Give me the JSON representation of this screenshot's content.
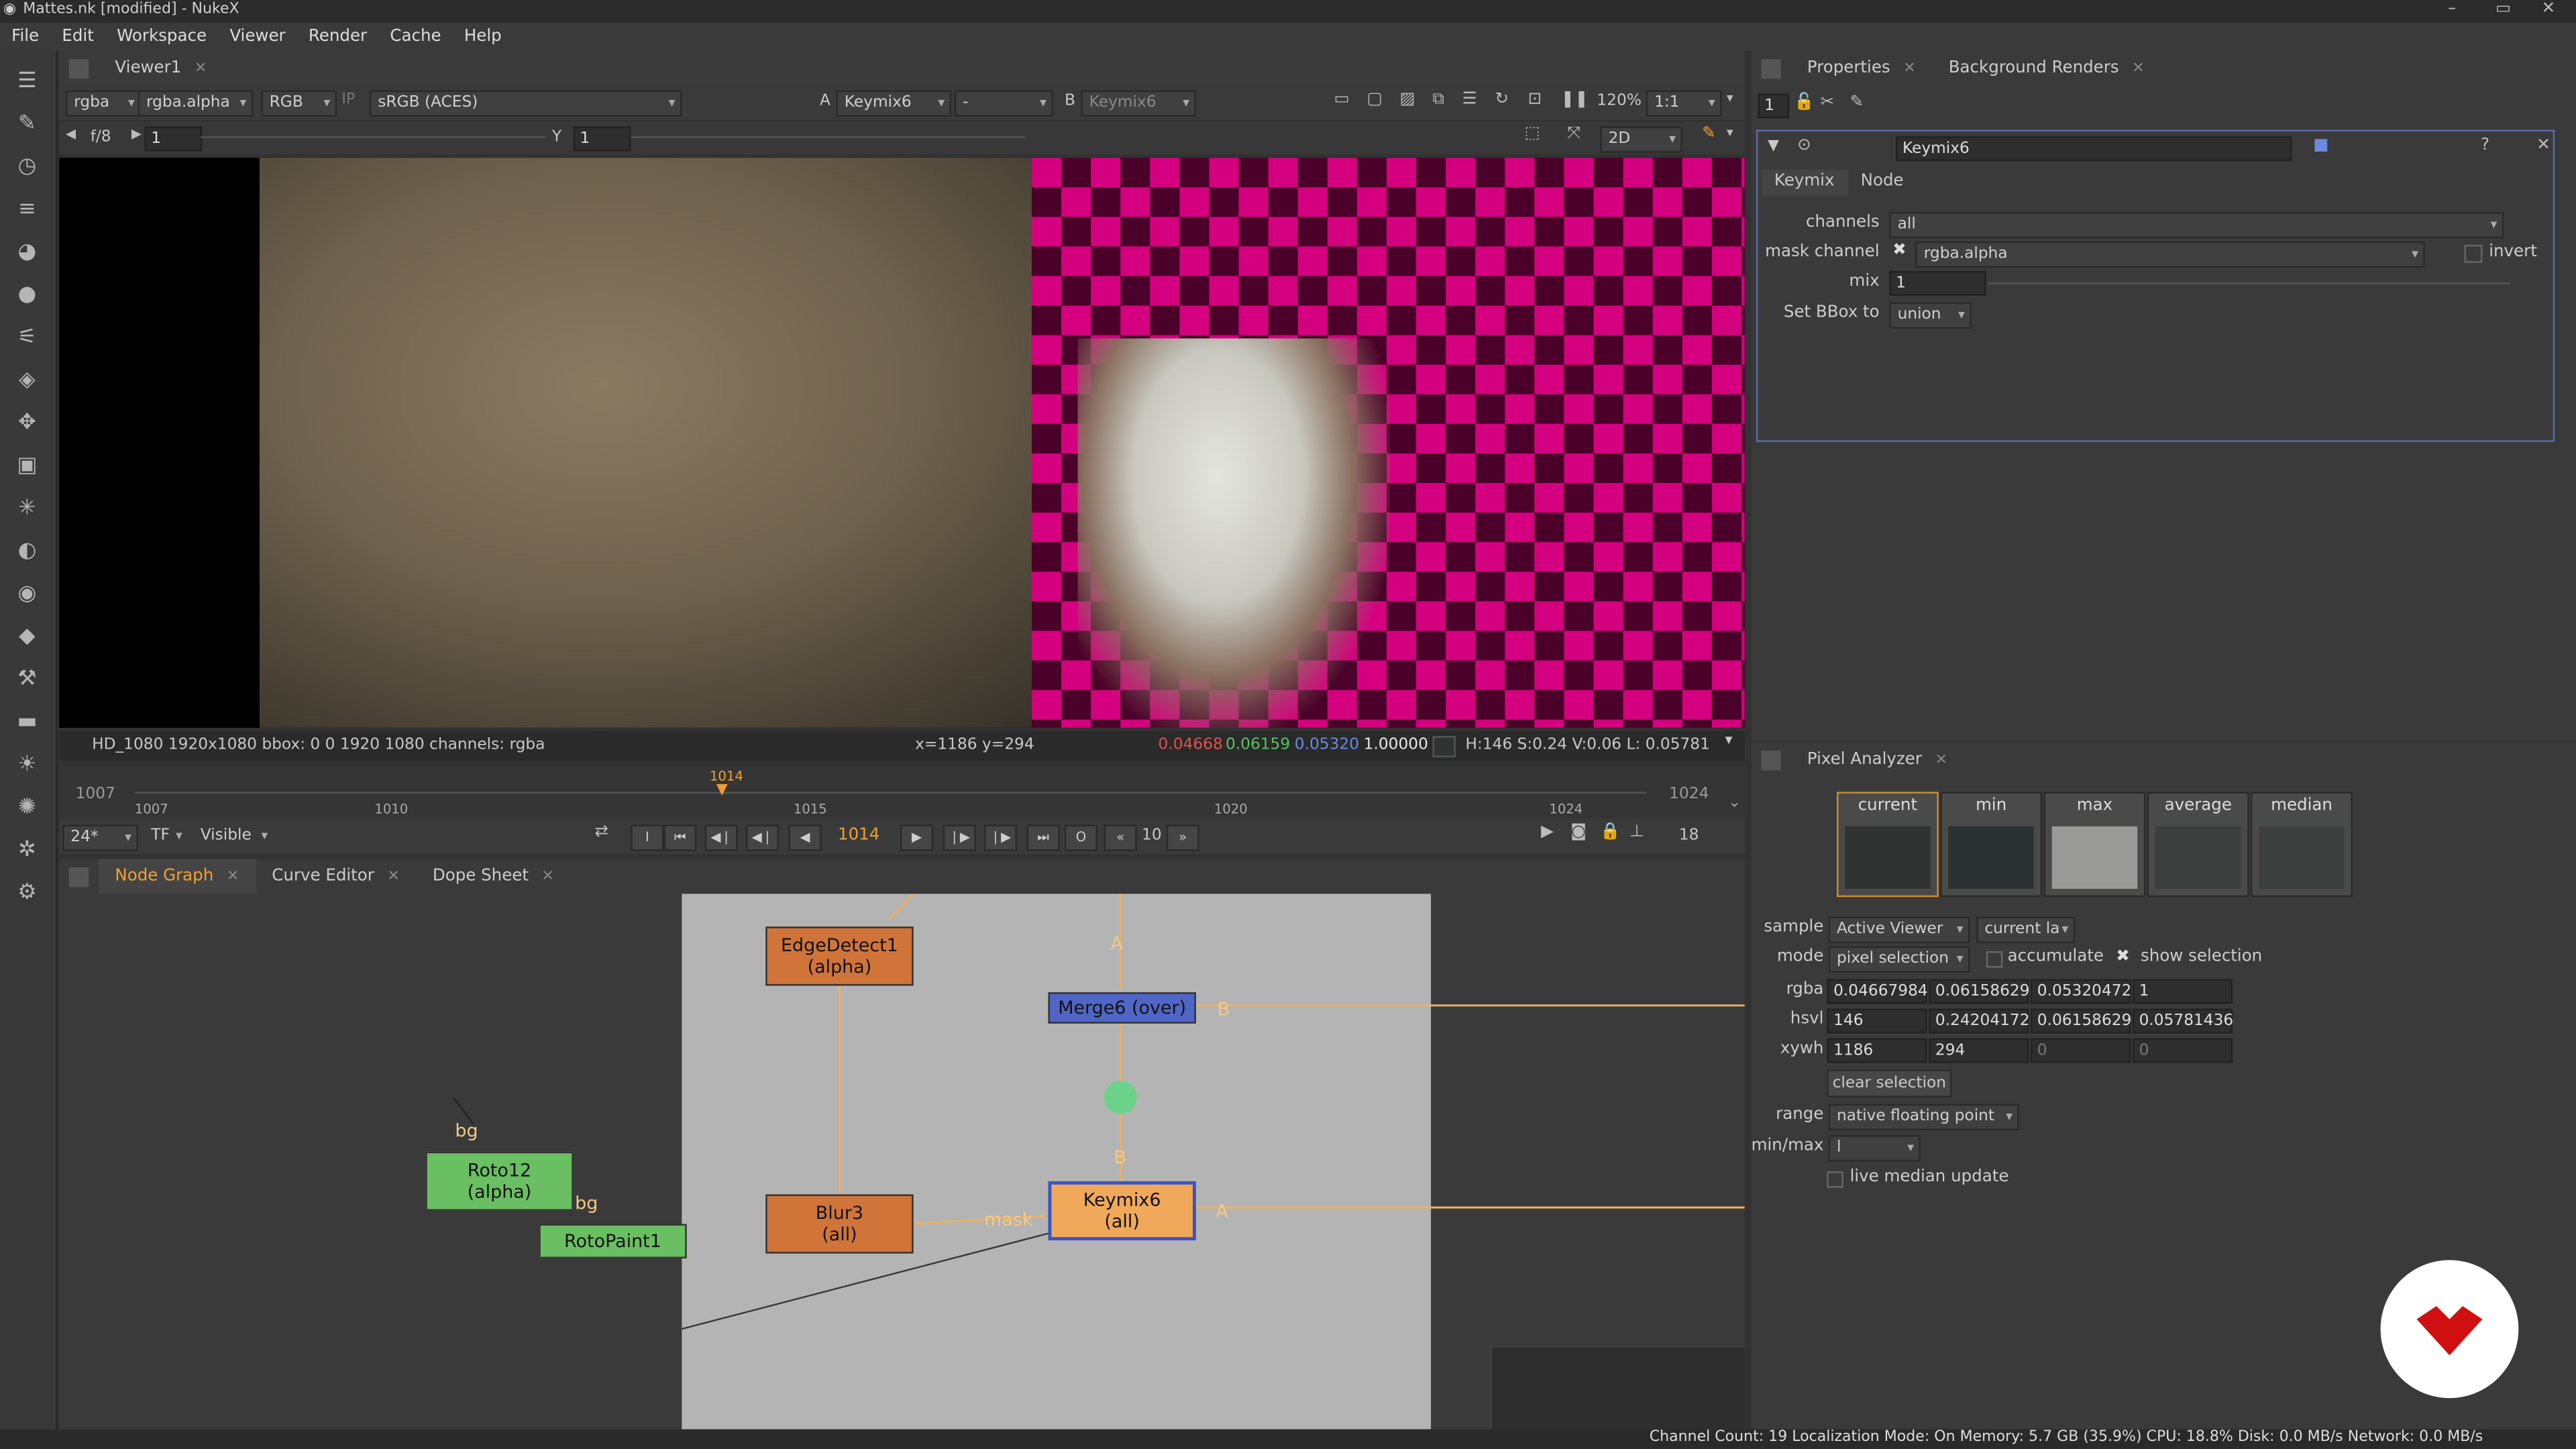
{
  "window": {
    "title": "Mattes.nk [modified] - NukeX",
    "controls": [
      "–",
      "▭",
      "✕"
    ]
  },
  "menu": [
    "File",
    "Edit",
    "Workspace",
    "Viewer",
    "Render",
    "Cache",
    "Help"
  ],
  "viewer": {
    "tab": "Viewer1",
    "channels": "rgba",
    "mask": "rgba.alpha",
    "display": "RGB",
    "ip": "IP",
    "lut": "sRGB (ACES)",
    "a_label": "A",
    "a_input": "Keymix6",
    "dash": "-",
    "b_label": "B",
    "b_input": "Keymix6",
    "zoom": "120%",
    "ratio": "1:1",
    "fstop": "f/8",
    "gain": "1",
    "y_label": "Y",
    "gamma": "1",
    "mode2d": "2D",
    "info_format": "HD_1080 1920x1080  bbox: 0 0 1920 1080 channels: rgba",
    "info_xy": "x=1186 y=294",
    "info_r": "0.04668",
    "info_g": "0.06159",
    "info_b": "0.05320",
    "info_a": "1.00000",
    "info_hsv": "H:146 S:0.24 V:0.06  L: 0.05781"
  },
  "timeline": {
    "start": "1007",
    "end": "1024",
    "current": "1014",
    "ticks": [
      "1007",
      "1010",
      "1015",
      "1020",
      "1024"
    ],
    "fps": "24*",
    "tf": "TF",
    "visible": "Visible",
    "frame_field": "1014",
    "step": "10",
    "range_end": "18"
  },
  "ng_tabs": [
    "Node Graph",
    "Curve Editor",
    "Dope Sheet"
  ],
  "nodes": {
    "edgedetect": "EdgeDetect1\n(alpha)",
    "edgedetect_l1": "EdgeDetect1",
    "edgedetect_l2": "(alpha)",
    "merge": "Merge6 (over)",
    "blur_l1": "Blur3",
    "blur_l2": "(all)",
    "keymix_l1": "Keymix6",
    "keymix_l2": "(all)",
    "roto_l1": "Roto12",
    "roto_l2": "(alpha)",
    "rotopaint": "RotoPaint1",
    "label_a1": "A",
    "label_b1": "B",
    "label_b2": "B",
    "label_a2": "A",
    "label_mask": "mask",
    "label_bg1": "bg",
    "label_bg2": "bg"
  },
  "properties": {
    "tabs": [
      "Properties",
      "Background Renders"
    ],
    "count": "1",
    "node_name": "Keymix6",
    "subtabs": [
      "Keymix",
      "Node"
    ],
    "channels_label": "channels",
    "channels_value": "all",
    "mask_label": "mask channel",
    "mask_value": "rgba.alpha",
    "invert": "invert",
    "mix_label": "mix",
    "mix_value": "1",
    "mix_ticks": [
      "0",
      "0.1",
      "0.2",
      "0.3",
      "0.4",
      "0.5",
      "0.6",
      "0.7",
      "0.8",
      "0.9",
      "1"
    ],
    "bbox_label": "Set BBox to",
    "bbox_value": "union"
  },
  "pixel_analyzer": {
    "tab": "Pixel Analyzer",
    "swatches": [
      "current",
      "min",
      "max",
      "average",
      "median"
    ],
    "swatch_colors": [
      "#2f3433",
      "#2c3231",
      "#9a9a98",
      "#3b3f3e",
      "#3c403f"
    ],
    "sample_label": "sample",
    "sample_value": "Active Viewer",
    "sample_layer": "current la",
    "mode_label": "mode",
    "mode_value": "pixel selection",
    "accumulate": "accumulate",
    "show_selection": "show selection",
    "rgba_label": "rgba",
    "rgba": [
      "0.04667984",
      "0.06158629",
      "0.05320472",
      "1"
    ],
    "hsvl_label": "hsvl",
    "hsvl": [
      "146",
      "0.24204172",
      "0.06158629",
      "0.05781436"
    ],
    "xywh_label": "xywh",
    "xywh": [
      "1186",
      "294",
      "0",
      "0"
    ],
    "clear": "clear selection",
    "range_label": "range",
    "range_value": "native floating point",
    "minmax_label": "min/max",
    "minmax_value": "l",
    "live_median": "live median update"
  },
  "status": "Channel Count: 19  Localization Mode: On  Memory: 5.7 GB (35.9%)  CPU: 18.8%  Disk: 0.0 MB/s  Network: 0.0 MB/s"
}
